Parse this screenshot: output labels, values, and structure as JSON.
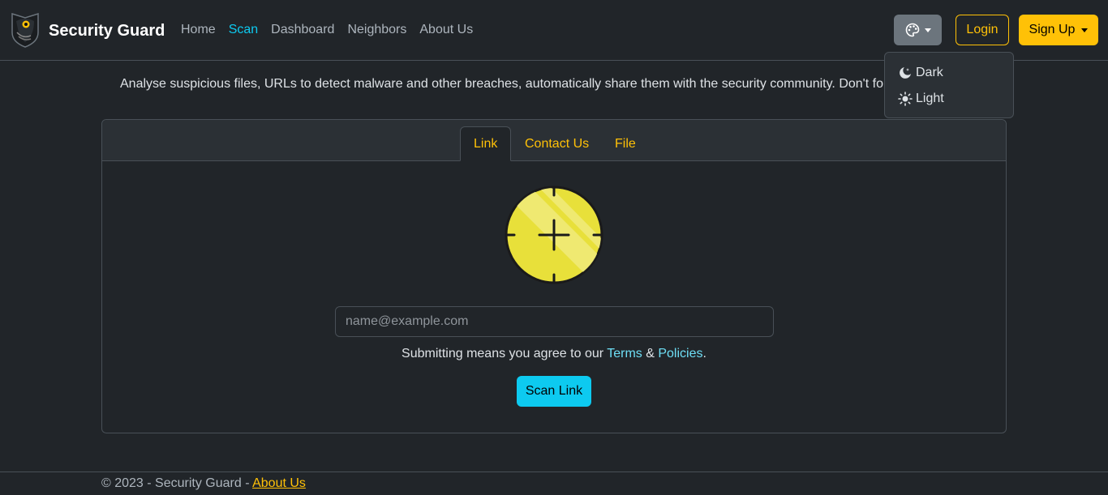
{
  "brand": {
    "name": "Security Guard",
    "logo_icon": "owl-shield-icon"
  },
  "nav": {
    "items": [
      {
        "label": "Home",
        "active": false
      },
      {
        "label": "Scan",
        "active": true
      },
      {
        "label": "Dashboard",
        "active": false
      },
      {
        "label": "Neighbors",
        "active": false
      },
      {
        "label": "About Us",
        "active": false
      }
    ]
  },
  "header_actions": {
    "theme_icon": "palette-icon",
    "login_label": "Login",
    "signup_label": "Sign Up"
  },
  "theme_menu": {
    "items": [
      {
        "label": "Dark",
        "icon": "moon-stars-icon"
      },
      {
        "label": "Light",
        "icon": "sun-icon"
      }
    ]
  },
  "intro_text": "Analyse suspicious files, URLs to detect malware and other breaches, automatically share them with the security community. Don't forg",
  "tabs": [
    {
      "label": "Link",
      "active": true
    },
    {
      "label": "Contact Us",
      "active": false
    },
    {
      "label": "File",
      "active": false
    }
  ],
  "scan_form": {
    "target_icon": "crosshair-target-icon",
    "input_placeholder": "name@example.com",
    "input_value": "",
    "agree_prefix": "Submitting means you agree to our",
    "terms_label": "Terms",
    "ampersand": "&",
    "policies_label": "Policies",
    "agree_suffix": ".",
    "submit_label": "Scan Link"
  },
  "footer": {
    "text": "© 2023 - Security Guard -",
    "link_label": "About Us"
  },
  "colors": {
    "background": "#212529",
    "accent_warning": "#ffc107",
    "accent_info": "#0dcaf0",
    "target_yellow": "#e8e03a"
  }
}
